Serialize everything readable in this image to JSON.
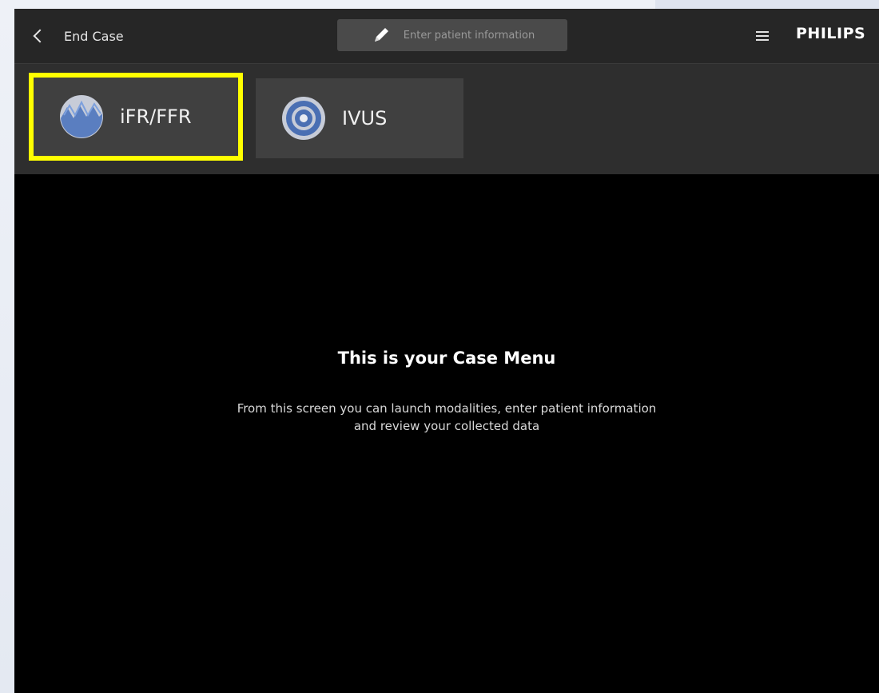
{
  "header": {
    "back_label": "End Case",
    "patient_button_label": "Enter patient information",
    "brand": "PHILIPS"
  },
  "modalities": [
    {
      "label": "iFR/FFR",
      "icon": "ifr-ffr-icon",
      "highlighted": true,
      "highlight_color": "#ffff00"
    },
    {
      "label": "IVUS",
      "icon": "ivus-icon",
      "highlighted": false
    }
  ],
  "main": {
    "title": "This is your Case Menu",
    "description_line1": "From this screen you can launch modalities, enter patient information",
    "description_line2": "and review your collected data"
  },
  "colors": {
    "background": "#000000",
    "header_bg": "#262626",
    "tile_bg": "#404040",
    "icon_blue": "#4a6fb3"
  }
}
